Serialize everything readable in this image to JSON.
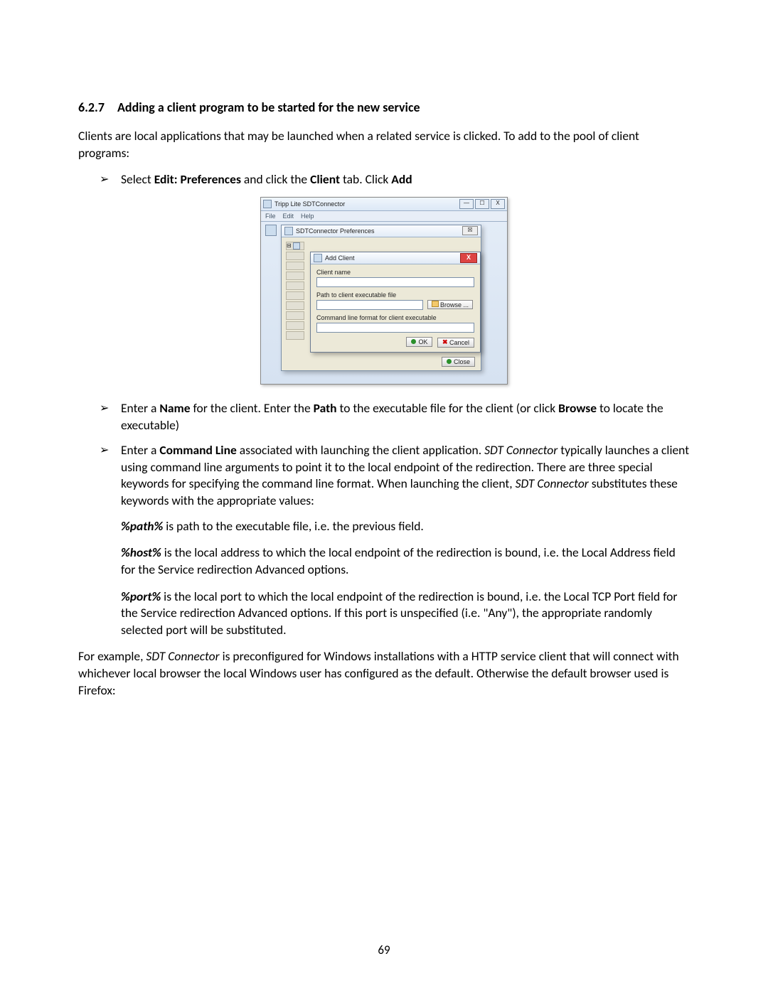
{
  "heading": {
    "number": "6.2.7",
    "title": "Adding a client program to be started for the new service"
  },
  "intro": "Clients are local applications that may be launched when a related service is clicked. To add to the pool of client programs:",
  "bullets": {
    "b1_pre": "Select ",
    "b1_bold1": "Edit: Preferences",
    "b1_mid": " and click the ",
    "b1_bold2": "Client",
    "b1_mid2": " tab. Click ",
    "b1_bold3": "Add",
    "b2_pre": "Enter a ",
    "b2_bold1": "Name",
    "b2_mid": " for the client. Enter the ",
    "b2_bold2": "Path",
    "b2_mid2": " to the executable file for the client (or click ",
    "b2_bold3": "Browse",
    "b2_end": " to locate the executable)",
    "b3_pre": "Enter a ",
    "b3_bold1": "Command Line",
    "b3_mid": " associated with launching the client application. ",
    "b3_ital": "SDT Connector",
    "b3_rest": " typically launches a client using command line arguments to point it to the local endpoint of the redirection. There are three special keywords for specifying the command line format. When launching the client, ",
    "b3_ital2": "SDT Connector",
    "b3_rest2": " substitutes these keywords with the appropriate values:"
  },
  "keywords": {
    "p1_k": "%path%",
    "p1_t": " is path to the executable file, i.e. the previous field.",
    "p2_k": "%host%",
    "p2_t": " is the local address to which the local endpoint of the redirection is bound, i.e. the Local Address field for the Service redirection Advanced options.",
    "p3_k": "%port%",
    "p3_t": " is the local port to which the local endpoint of the redirection is bound, i.e. the Local TCP Port field for the Service redirection Advanced options. If this port is unspecified (i.e. \"Any\"), the appropriate randomly selected port will be substituted."
  },
  "closing_pre": "For example, ",
  "closing_ital": "SDT Connector",
  "closing_rest": " is preconfigured for Windows installations with a HTTP service client that will connect with whichever local browser the local Windows user has configured as the default. Otherwise the default browser used is Firefox:",
  "page_number": "69",
  "screenshot": {
    "main_window_title": "Tripp Lite SDTConnector",
    "menu": {
      "file": "File",
      "edit": "Edit",
      "help": "Help"
    },
    "win_min": "—",
    "win_max": "☐",
    "win_close": "X",
    "prefs_title": "SDTConnector Preferences",
    "prefs_close_x": "☒",
    "close_btn": "Close",
    "addclient": {
      "title": "Add Client",
      "label_name": "Client name",
      "label_path": "Path to client executable file",
      "label_cmd": "Command line format for client executable",
      "browse": "Browse ...",
      "ok": "OK",
      "cancel": "Cancel"
    }
  }
}
